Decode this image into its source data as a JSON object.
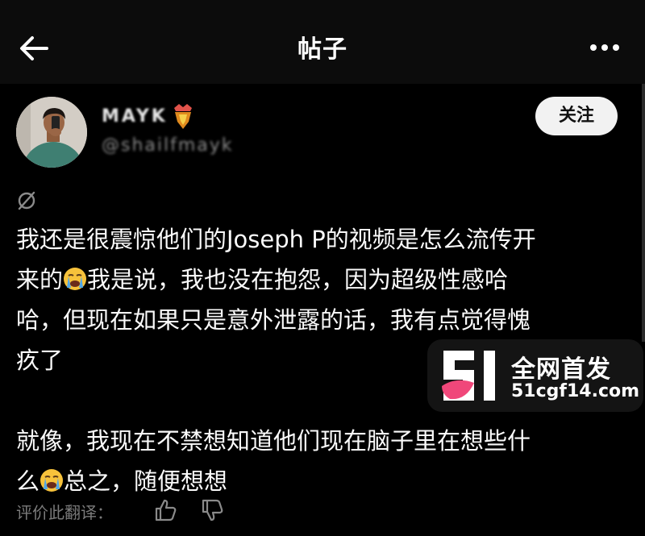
{
  "header": {
    "title": "帖子",
    "back_icon": "arrow-left-icon",
    "more_icon": "more-horizontal-icon"
  },
  "author": {
    "username": "MAYK",
    "handle": "@shailfmayk",
    "badge_icon": "shield-badge-icon",
    "follow_label": "关注"
  },
  "post": {
    "language_icon": "no-translation-icon",
    "para1_a": "我还是很震惊他们的Joseph P的视频是怎么流传开\n来的",
    "para1_b": "我是说，我也没在抱怨，因为超级性感哈\n哈，但现在如果只是意外泄露的话，我有点觉得愧\n疚了",
    "para2_a": "就像，我现在不禁想知道他们现在脑子里在想些什\n么",
    "para2_b": "总之，随便想想",
    "emoji": "loudly-crying-face-icon"
  },
  "watermark": {
    "line1": "全网首发",
    "line2": "51cgf14.com",
    "logo": "51-logo-icon"
  },
  "footer": {
    "rate_label": "评价此翻译：",
    "like_icon": "thumbs-up-icon",
    "dislike_icon": "thumbs-down-icon"
  }
}
